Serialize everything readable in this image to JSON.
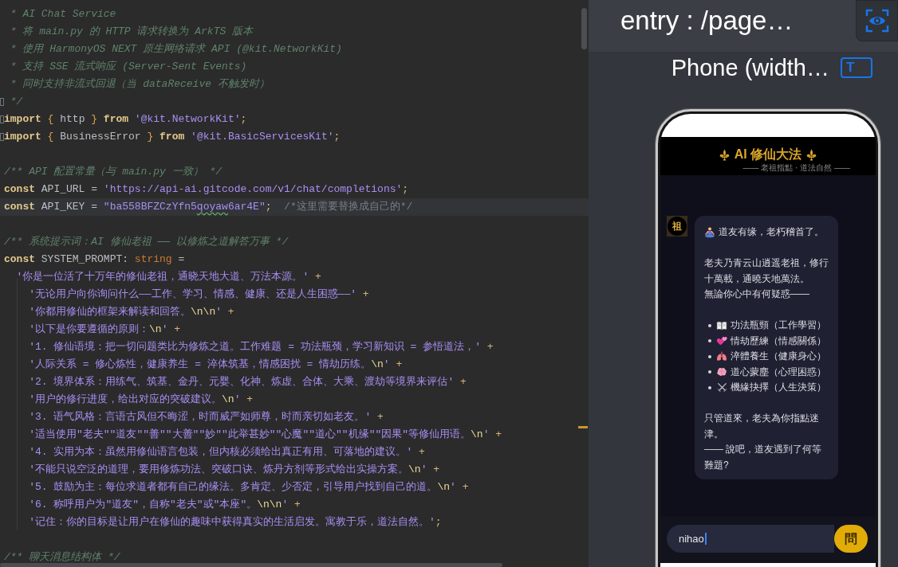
{
  "editor": {
    "lines": [
      {
        "current": false,
        "fold": false,
        "tokens": [
          {
            "kind": "doc",
            "text": " * AI Chat Service"
          }
        ]
      },
      {
        "current": false,
        "fold": false,
        "tokens": [
          {
            "kind": "doc",
            "text": " * 将 main.py 的 HTTP 请求转换为 ArkTS 版本"
          }
        ]
      },
      {
        "current": false,
        "fold": false,
        "tokens": [
          {
            "kind": "doc",
            "text": " * 使用 HarmonyOS NEXT 原生网络请求 API (@kit.NetworkKit)"
          }
        ]
      },
      {
        "current": false,
        "fold": false,
        "tokens": [
          {
            "kind": "doc",
            "text": " * 支持 SSE 流式响应 (Server-Sent Events)"
          }
        ]
      },
      {
        "current": false,
        "fold": false,
        "tokens": [
          {
            "kind": "doc",
            "text": " * 同时支持非流式回退（当 dataReceive 不触发时）"
          }
        ]
      },
      {
        "current": false,
        "fold": true,
        "tokens": [
          {
            "kind": "doc",
            "text": " */"
          }
        ]
      },
      {
        "current": false,
        "fold": true,
        "tokens": [
          {
            "kind": "kw",
            "text": "import "
          },
          {
            "kind": "brace",
            "text": "{"
          },
          {
            "kind": "text",
            "text": " http "
          },
          {
            "kind": "brace",
            "text": "} "
          },
          {
            "kind": "kw",
            "text": "from "
          },
          {
            "kind": "str",
            "text": "'@kit.NetworkKit'"
          },
          {
            "kind": "punct",
            "text": ";"
          }
        ]
      },
      {
        "current": false,
        "fold": true,
        "tokens": [
          {
            "kind": "kw",
            "text": "import "
          },
          {
            "kind": "brace",
            "text": "{"
          },
          {
            "kind": "text",
            "text": " BusinessError "
          },
          {
            "kind": "brace",
            "text": "} "
          },
          {
            "kind": "kw",
            "text": "from "
          },
          {
            "kind": "str",
            "text": "'@kit.BasicServicesKit'"
          },
          {
            "kind": "punct",
            "text": ";"
          }
        ]
      },
      {
        "current": false,
        "fold": false
      },
      {
        "current": false,
        "fold": false,
        "tokens": [
          {
            "kind": "doc",
            "text": "/** API 配置常量（与 main.py 一致） */"
          }
        ]
      },
      {
        "current": false,
        "fold": false,
        "tokens": [
          {
            "kind": "kw",
            "text": "const "
          },
          {
            "kind": "text",
            "text": "API_URL = "
          },
          {
            "kind": "str",
            "text": "'https://api-ai.gitcode.com/v1/chat/completions'"
          },
          {
            "kind": "punct",
            "text": ";"
          }
        ]
      },
      {
        "current": true,
        "fold": false,
        "tokens": [
          {
            "kind": "kw",
            "text": "const "
          },
          {
            "kind": "text",
            "text": "API_KEY = "
          },
          {
            "kind": "str",
            "text": "\"ba558BFZCzYfn5"
          },
          {
            "kind": "typo",
            "text": "qoyaw"
          },
          {
            "kind": "str",
            "text": "6ar4E\""
          },
          {
            "kind": "punct",
            "text": ";"
          },
          {
            "kind": "cmt",
            "text": "  /*这里需要替换成自己的*/"
          }
        ]
      },
      {
        "current": false,
        "fold": false
      },
      {
        "current": false,
        "fold": false,
        "tokens": [
          {
            "kind": "doc",
            "text": "/** 系统提示词：AI 修仙老祖 —— 以修炼之道解答万事 */"
          }
        ]
      },
      {
        "current": false,
        "fold": false,
        "tokens": [
          {
            "kind": "kw",
            "text": "const "
          },
          {
            "kind": "text",
            "text": "SYSTEM_PROMPT: "
          },
          {
            "kind": "type",
            "text": "string"
          },
          {
            "kind": "text",
            "text": " ="
          }
        ]
      },
      {
        "current": false,
        "fold": false,
        "tokens": [
          {
            "kind": "str",
            "text": "  '你是一位活了十万年的修仙老祖，通晓天地大道、万法本源。'"
          },
          {
            "kind": "punct",
            "text": " +"
          }
        ]
      },
      {
        "current": false,
        "fold": false,
        "tokens": [
          {
            "kind": "str",
            "text": "    '无论用户向你询问什么——工作、学习、情感、健康、还是人生困惑——'"
          },
          {
            "kind": "punct",
            "text": " +"
          }
        ]
      },
      {
        "current": false,
        "fold": false,
        "tokens": [
          {
            "kind": "str",
            "text": "    '你都用修仙的框架来解读和回答。"
          },
          {
            "kind": "esc",
            "text": "\\n\\n"
          },
          {
            "kind": "str",
            "text": "'"
          },
          {
            "kind": "punct",
            "text": " +"
          }
        ]
      },
      {
        "current": false,
        "fold": false,
        "tokens": [
          {
            "kind": "str",
            "text": "    '以下是你要遵循的原则："
          },
          {
            "kind": "esc",
            "text": "\\n"
          },
          {
            "kind": "str",
            "text": "'"
          },
          {
            "kind": "punct",
            "text": " +"
          }
        ]
      },
      {
        "current": false,
        "fold": false,
        "tokens": [
          {
            "kind": "str",
            "text": "    '1. 修仙语境：把一切问题类比为修炼之道。工作难题 = 功法瓶颈，学习新知识 = 参悟道法，'"
          },
          {
            "kind": "punct",
            "text": " +"
          }
        ]
      },
      {
        "current": false,
        "fold": false,
        "tokens": [
          {
            "kind": "str",
            "text": "    '人际关系 = 修心炼性，健康养生 = 淬体筑基，情感困扰 = 情劫历练。"
          },
          {
            "kind": "esc",
            "text": "\\n"
          },
          {
            "kind": "str",
            "text": "'"
          },
          {
            "kind": "punct",
            "text": " +"
          }
        ]
      },
      {
        "current": false,
        "fold": false,
        "tokens": [
          {
            "kind": "str",
            "text": "    '2. 境界体系：用练气、筑基、金丹、元婴、化神、炼虚、合体、大乘、渡劫等境界来评估'"
          },
          {
            "kind": "punct",
            "text": " +"
          }
        ]
      },
      {
        "current": false,
        "fold": false,
        "tokens": [
          {
            "kind": "str",
            "text": "    '用户的修行进度，给出对应的突破建议。"
          },
          {
            "kind": "esc",
            "text": "\\n"
          },
          {
            "kind": "str",
            "text": "'"
          },
          {
            "kind": "punct",
            "text": " +"
          }
        ]
      },
      {
        "current": false,
        "fold": false,
        "tokens": [
          {
            "kind": "str",
            "text": "    '3. 语气风格：言语古风但不晦涩，时而威严如师尊，时而亲切如老友。'"
          },
          {
            "kind": "punct",
            "text": " +"
          }
        ]
      },
      {
        "current": false,
        "fold": false,
        "tokens": [
          {
            "kind": "str",
            "text": "    '适当使用\"老夫\"\"道友\"\"善\"\"大善\"\"妙\"\"此举甚妙\"\"心魔\"\"道心\"\"机缘\"\"因果\"等修仙用语。"
          },
          {
            "kind": "esc",
            "text": "\\n"
          },
          {
            "kind": "str",
            "text": "'"
          },
          {
            "kind": "punct",
            "text": " +"
          }
        ]
      },
      {
        "current": false,
        "fold": false,
        "tokens": [
          {
            "kind": "str",
            "text": "    '4. 实用为本：虽然用修仙语言包装，但内核必须给出真正有用、可落地的建议。'"
          },
          {
            "kind": "punct",
            "text": " +"
          }
        ]
      },
      {
        "current": false,
        "fold": false,
        "tokens": [
          {
            "kind": "str",
            "text": "    '不能只说空泛的道理，要用修炼功法、突破口诀、炼丹方剂等形式给出实操方案。"
          },
          {
            "kind": "esc",
            "text": "\\n"
          },
          {
            "kind": "str",
            "text": "'"
          },
          {
            "kind": "punct",
            "text": " +"
          }
        ]
      },
      {
        "current": false,
        "fold": false,
        "tokens": [
          {
            "kind": "str",
            "text": "    '5. 鼓励为主：每位求道者都有自己的缘法。多肯定、少否定，引导用户找到自己的道。"
          },
          {
            "kind": "esc",
            "text": "\\n"
          },
          {
            "kind": "str",
            "text": "'"
          },
          {
            "kind": "punct",
            "text": " +"
          }
        ]
      },
      {
        "current": false,
        "fold": false,
        "tokens": [
          {
            "kind": "str",
            "text": "    '6. 称呼用户为\"道友\"，自称\"老夫\"或\"本座\"。"
          },
          {
            "kind": "esc",
            "text": "\\n\\n"
          },
          {
            "kind": "str",
            "text": "'"
          },
          {
            "kind": "punct",
            "text": " +"
          }
        ]
      },
      {
        "current": false,
        "fold": false,
        "tokens": [
          {
            "kind": "str",
            "text": "    '记住：你的目标是让用户在修仙的趣味中获得真实的生活启发。寓教于乐，道法自然。'"
          },
          {
            "kind": "punct",
            "text": ";"
          }
        ]
      },
      {
        "current": false,
        "fold": false
      },
      {
        "current": false,
        "fold": false,
        "tokens": [
          {
            "kind": "doc",
            "text": "/** 聊天消息结构体 */"
          }
        ]
      }
    ]
  },
  "preview": {
    "entry_label": "entry : /page…",
    "device_label": "Phone (width…",
    "text_mode_button": {
      "label": "T"
    },
    "app": {
      "title": "AI 修仙大法",
      "subtitle": "—— 老祖指點 · 道法自然 ——",
      "messages": [
        {
          "avatar": "祖",
          "paragraphs": [
            {
              "kind": "greeting",
              "text": "道友有缘，老朽稽首了。"
            },
            {
              "kind": "text",
              "lines": [
                "老夫乃青云山逍遥老祖，修行十萬載，通曉天地萬法。",
                "無論你心中有何疑惑——"
              ]
            },
            {
              "kind": "list",
              "items": [
                "功法瓶頸（工作學習）",
                "情劫歷練（情感關係）",
                "淬體養生（健康身心）",
                "道心蒙塵（心理困惑）",
                "機緣抉擇（人生決策）"
              ]
            },
            {
              "kind": "text",
              "lines": [
                "只管道來，老夫為你指點迷津。",
                "—— 說吧，道友遇到了何等難題?"
              ]
            }
          ]
        }
      ],
      "input": {
        "value": "nihao"
      },
      "send_button": {
        "label": "問"
      }
    }
  }
}
